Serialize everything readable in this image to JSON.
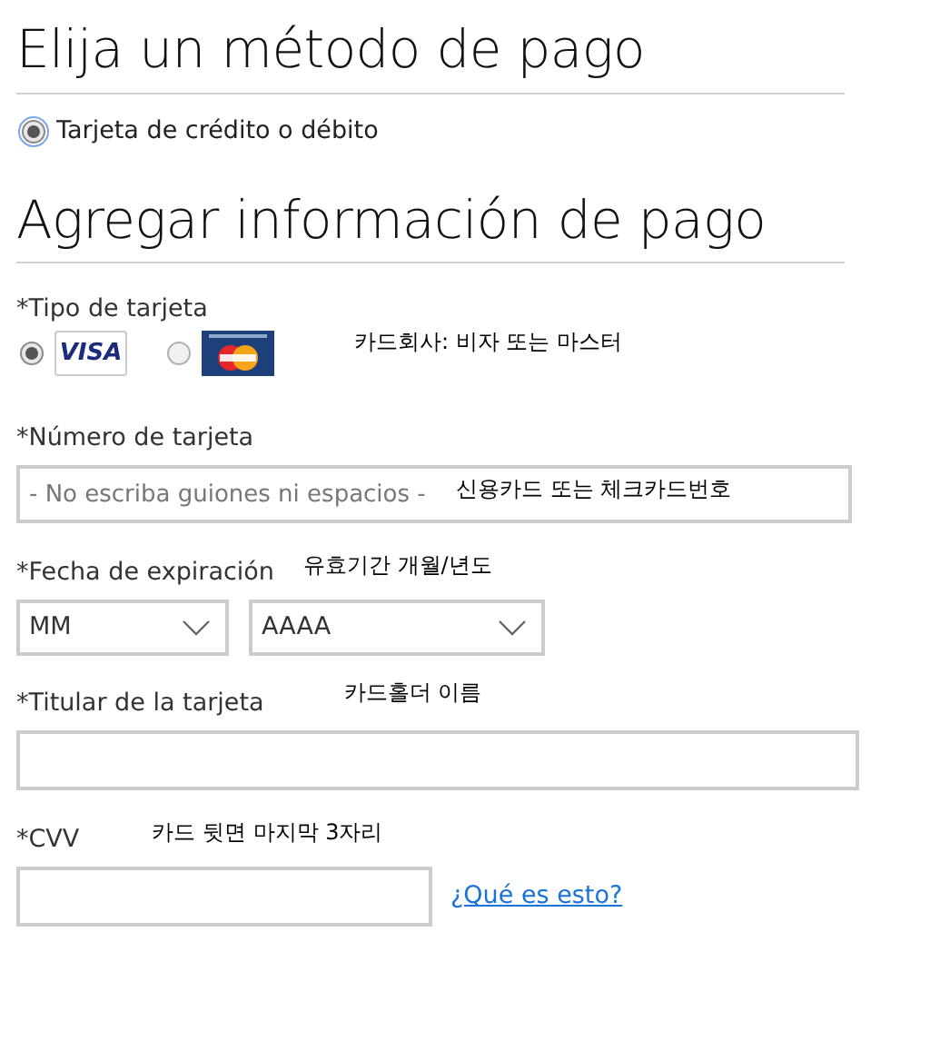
{
  "payment_method": {
    "title": "Elija un método de pago",
    "options": [
      {
        "label": "Tarjeta de crédito o débito",
        "selected": true
      }
    ]
  },
  "payment_info": {
    "title": "Agregar información de pago",
    "card_type": {
      "label": "*Tipo de tarjeta",
      "note": "카드회사: 비자 또는 마스터",
      "options": [
        {
          "kind": "visa",
          "logo_text": "VISA",
          "selected": true
        },
        {
          "kind": "mastercard",
          "selected": false
        }
      ]
    },
    "card_number": {
      "label": "*Número de tarjeta",
      "placeholder": "- No escriba guiones ni espacios -",
      "note": "신용카드 또는 체크카드번호"
    },
    "expiration": {
      "label": "*Fecha de expiración",
      "note": "유효기간 개월/년도",
      "month": {
        "value": "MM"
      },
      "year": {
        "value": "AAAA"
      }
    },
    "cardholder": {
      "label": "*Titular de la tarjeta",
      "note": "카드홀더 이름"
    },
    "cvv": {
      "label": "*CVV",
      "note": "카드 뒷면 마지막 3자리",
      "link": "¿Qué es esto?"
    }
  }
}
